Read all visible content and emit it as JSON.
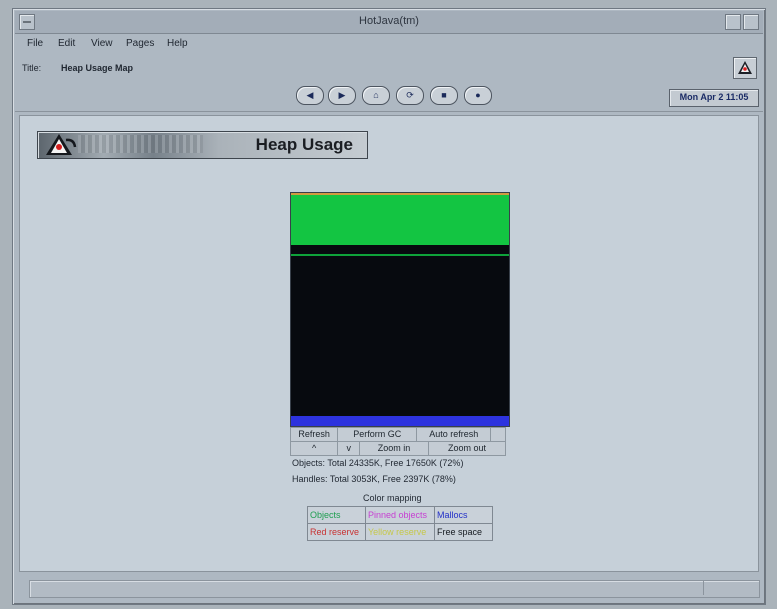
{
  "window": {
    "title": "HotJava(tm)"
  },
  "menu": [
    "File",
    "Edit",
    "View",
    "Pages",
    "Help"
  ],
  "title_row": {
    "label": "Title:",
    "value": "Heap Usage Map",
    "logo_icon": "duke-icon"
  },
  "nav": {
    "buttons": [
      {
        "icon": "back-arrow-icon",
        "glyph": "◀"
      },
      {
        "icon": "forward-arrow-icon",
        "glyph": "▶"
      },
      {
        "icon": "home-icon",
        "glyph": "⌂"
      },
      {
        "icon": "reload-icon",
        "glyph": "⟳"
      },
      {
        "icon": "stop-icon",
        "glyph": "■"
      },
      {
        "icon": "info-icon",
        "glyph": "●"
      }
    ],
    "date": "Mon Apr 2 11:05"
  },
  "banner": {
    "text": "Heap Usage",
    "icon": "duke-icon"
  },
  "heap_map": {
    "regions": [
      {
        "name": "Objects",
        "color": "#13c542"
      },
      {
        "name": "Free space",
        "color": "#070a0f"
      },
      {
        "name": "Mallocs",
        "color": "#2d33de"
      }
    ]
  },
  "controls": {
    "row1": [
      "Refresh",
      "Perform GC",
      "Auto refresh",
      ""
    ],
    "row2": [
      "^",
      "v",
      "Zoom in",
      "Zoom out"
    ]
  },
  "stats": {
    "objects": "Objects: Total 24335K, Free 17650K (72%)",
    "handles": "Handles: Total 3053K, Free 2397K (78%)"
  },
  "color_mapping": {
    "title": "Color mapping",
    "rows": [
      [
        {
          "label": "Objects",
          "color": "#1f9e50"
        },
        {
          "label": "Pinned objects",
          "color": "#c63fd2"
        },
        {
          "label": "Mallocs",
          "color": "#2330c8"
        }
      ],
      [
        {
          "label": "Red reserve",
          "color": "#c83232"
        },
        {
          "label": "Yellow reserve",
          "color": "#c6c84a"
        },
        {
          "label": "Free space",
          "color": "#151a20"
        }
      ]
    ]
  }
}
